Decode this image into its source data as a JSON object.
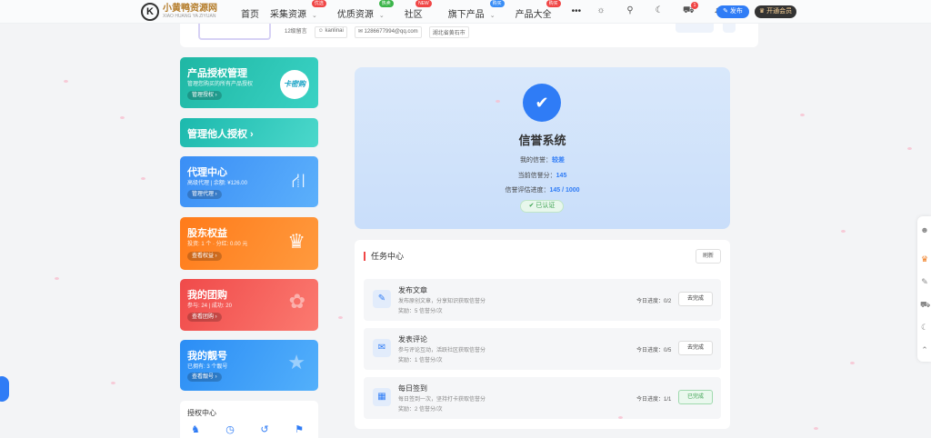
{
  "header": {
    "logo_text": "小黄鸭资源网",
    "logo_sub": "XIAO HUANG YA ZIYUAN",
    "nav": [
      {
        "label": "首页",
        "badge": "",
        "has_chevron": false
      },
      {
        "label": "采集资源",
        "badge": "优选",
        "has_chevron": true
      },
      {
        "label": "优质资源",
        "badge": "热卖",
        "has_chevron": true
      },
      {
        "label": "社区",
        "badge": "NEW",
        "has_chevron": false
      },
      {
        "label": "旗下产品",
        "badge": "购买",
        "has_chevron": true
      },
      {
        "label": "产品大全",
        "badge": "购买",
        "has_chevron": false
      },
      {
        "label": "•••",
        "badge": "",
        "has_chevron": false
      }
    ],
    "cart_count": "1",
    "publish_label": "发布",
    "vip_label": "开通会员"
  },
  "profile": {
    "level": "12级留言",
    "username": "kanlinai",
    "email": "1286677994@qq.com",
    "location": "湖北省黄石市"
  },
  "cards": {
    "license": {
      "title": "产品授权管理",
      "sub": "管理您购买的所有产品授权",
      "btn": "管理授权",
      "badge": "卡密购"
    },
    "others": {
      "title": "管理他人授权"
    },
    "agent": {
      "title": "代理中心",
      "sub": "高级代理 | 余额: ¥126.00",
      "btn": "管理代理"
    },
    "equity": {
      "title": "股东权益",
      "sub": "投资: 1 个 · 分红: 0.00 元",
      "btn": "查看权益"
    },
    "group": {
      "title": "我的团购",
      "sub": "参与: 24 | 成功: 20",
      "btn": "查看团购"
    },
    "numbers": {
      "title": "我的靓号",
      "sub": "已拥有: 3 个靓号",
      "btn": "查看靓号"
    }
  },
  "auth_center": {
    "title": "授权中心"
  },
  "credit": {
    "title": "信誉系统",
    "my_credit_label": "我的信誉：",
    "my_credit_value": "较差",
    "score_label": "当前信誉分：",
    "score_value": "145",
    "progress_label": "信誉评估进度：",
    "progress_value": "145 / 1000",
    "verified_label": "已认证"
  },
  "tasks": {
    "title": "任务中心",
    "refresh_label": "刷新",
    "items": [
      {
        "name": "发布文章",
        "desc": "发布原创文章，分享知识获取信誉分",
        "reward": "奖励：5 信誉分/次",
        "progress": "今日进度：0/2",
        "button": "去完成",
        "done": false
      },
      {
        "name": "发表评论",
        "desc": "参与评论互动，活跃社区获取信誉分",
        "reward": "奖励：1 信誉分/次",
        "progress": "今日进度：0/5",
        "button": "去完成",
        "done": false
      },
      {
        "name": "每日签到",
        "desc": "每日签到一次，坚持打卡获取信誉分",
        "reward": "奖励：2 信誉分/次",
        "progress": "今日进度：1/1",
        "button": "已完成",
        "done": true
      }
    ]
  },
  "colors": {
    "accent": "#2f7cf6",
    "danger": "#f04646",
    "success": "#3aa14f"
  }
}
